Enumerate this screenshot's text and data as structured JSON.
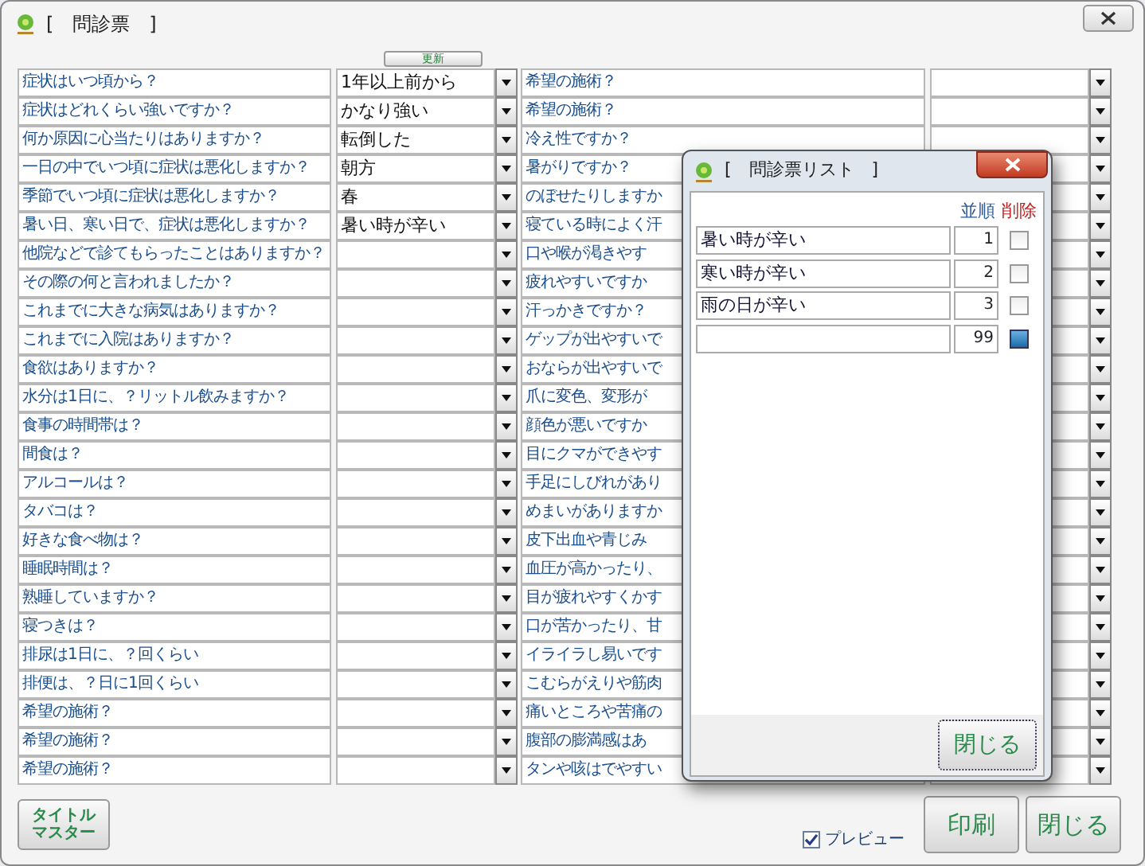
{
  "window": {
    "title": "[　問診票　]"
  },
  "update_button": "更新",
  "left_rows": [
    {
      "question": "症状はいつ頃から？",
      "answer": "1年以上前から"
    },
    {
      "question": "症状はどれくらい強いですか？",
      "answer": "かなり強い"
    },
    {
      "question": "何か原因に心当たりはありますか？",
      "answer": "転倒した"
    },
    {
      "question": "一日の中でいつ頃に症状は悪化しますか？",
      "answer": "朝方"
    },
    {
      "question": "季節でいつ頃に症状は悪化しますか？",
      "answer": "春"
    },
    {
      "question": "暑い日、寒い日で、症状は悪化しますか？",
      "answer": "暑い時が辛い"
    },
    {
      "question": "他院などで診てもらったことはありますか？"
    },
    {
      "question": "その際の何と言われましたか？"
    },
    {
      "question": "これまでに大きな病気はありますか？"
    },
    {
      "question": "これまでに入院はありますか？"
    },
    {
      "question": "食欲はありますか？"
    },
    {
      "question": "水分は1日に、？リットル飲みますか？"
    },
    {
      "question": "食事の時間帯は？"
    },
    {
      "question": "間食は？"
    },
    {
      "question": "アルコールは？"
    },
    {
      "question": "タバコは？"
    },
    {
      "question": "好きな食べ物は？"
    },
    {
      "question": "睡眠時間は？"
    },
    {
      "question": "熟睡していますか？"
    },
    {
      "question": "寝つきは？"
    },
    {
      "question": "排尿は1日に、？回くらい"
    },
    {
      "question": "排便は、？日に1回くらい"
    },
    {
      "question": "希望の施術？"
    },
    {
      "question": "希望の施術？"
    },
    {
      "question": "希望の施術？"
    }
  ],
  "right_rows": [
    {
      "question": "希望の施術？"
    },
    {
      "question": "希望の施術？"
    },
    {
      "question": "冷え性ですか？"
    },
    {
      "question": "暑がりですか？"
    },
    {
      "question": "のぼせたりしますか"
    },
    {
      "question": "寝ている時によく汗"
    },
    {
      "question": "口や喉が渇きやす"
    },
    {
      "question": "疲れやすいですか"
    },
    {
      "question": "汗っかきですか？"
    },
    {
      "question": "ゲップが出やすいで"
    },
    {
      "question": "おならが出やすいで"
    },
    {
      "question": "爪に変色、変形が"
    },
    {
      "question": "顔色が悪いですか"
    },
    {
      "question": "目にクマができやす"
    },
    {
      "question": "手足にしびれがあり"
    },
    {
      "question": "めまいがありますか"
    },
    {
      "question": "皮下出血や青じみ"
    },
    {
      "question": "血圧が高かったり、"
    },
    {
      "question": "目が疲れやすくかす"
    },
    {
      "question": "口が苦かったり、甘"
    },
    {
      "question": "イライラし易いです"
    },
    {
      "question": "こむらがえりや筋肉"
    },
    {
      "question": "痛いところや苦痛の"
    },
    {
      "question": "腹部の膨満感はあ"
    },
    {
      "question": "タンや咳はでやすい"
    }
  ],
  "title_master_button": [
    "タイトル",
    "マスター"
  ],
  "preview": {
    "label": "プレビュー",
    "checked": true
  },
  "print_button": "印刷",
  "close_button": "閉じる",
  "dialog": {
    "title": "[　問診票リスト　]",
    "order_header": "並順",
    "delete_header": "削除",
    "items": [
      {
        "text": "暑い時が辛い",
        "order": "1",
        "checked": false
      },
      {
        "text": "寒い時が辛い",
        "order": "2",
        "checked": false
      },
      {
        "text": "雨の日が辛い",
        "order": "3",
        "checked": false
      },
      {
        "order": "99",
        "checked": true
      }
    ],
    "close_button": "閉じる"
  }
}
